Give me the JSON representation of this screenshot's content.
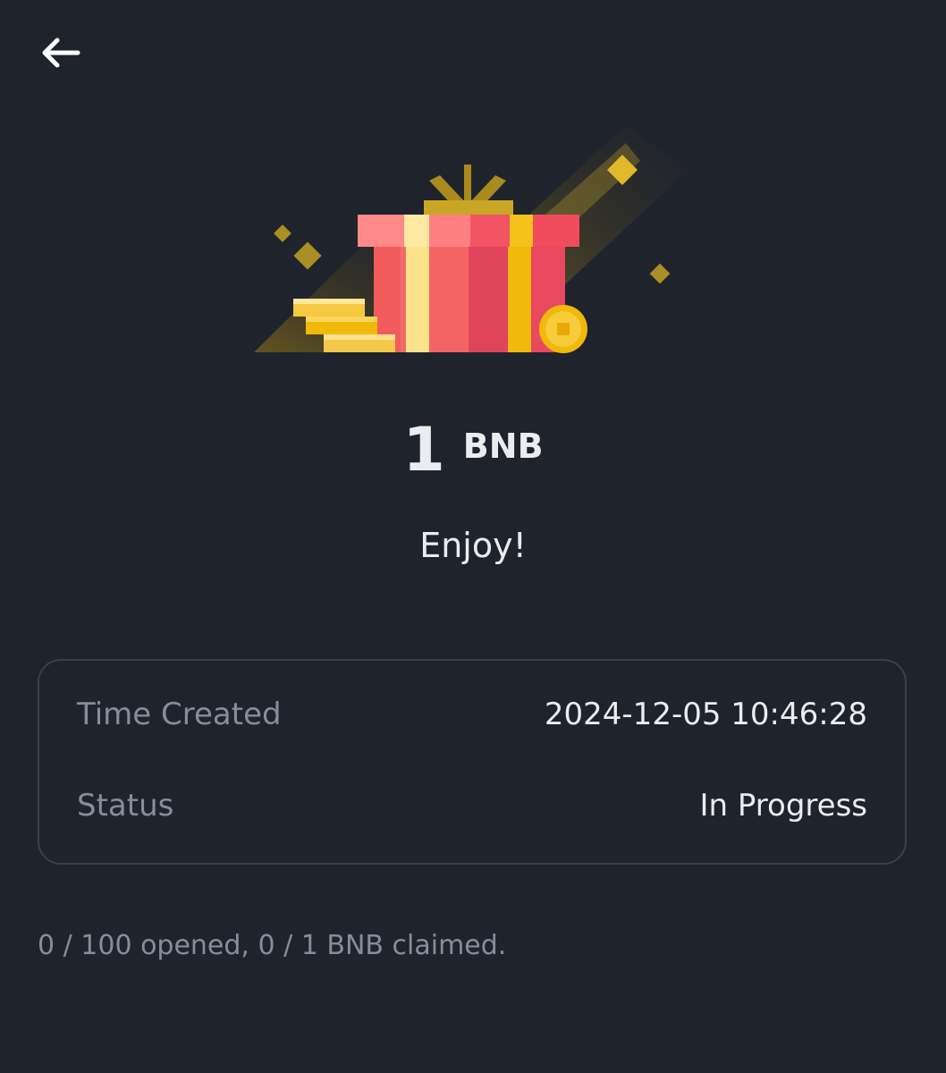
{
  "header": {
    "back_icon": "arrow-left-icon"
  },
  "gift": {
    "illustration_icon": "gift-box-icon",
    "amount": "1",
    "unit": "BNB",
    "message": "Enjoy!"
  },
  "details": {
    "time_created_label": "Time Created",
    "time_created_value": "2024-12-05 10:46:28",
    "status_label": "Status",
    "status_value": "In Progress"
  },
  "footer": {
    "progress_text": "0 / 100 opened, 0 / 1 BNB claimed."
  },
  "colors": {
    "background": "#1f232c",
    "text_primary": "#eaecef",
    "text_secondary": "#848e9c",
    "card_border": "#3a404c",
    "gift_red": "#f6465d",
    "gift_gold": "#f0b90b"
  }
}
